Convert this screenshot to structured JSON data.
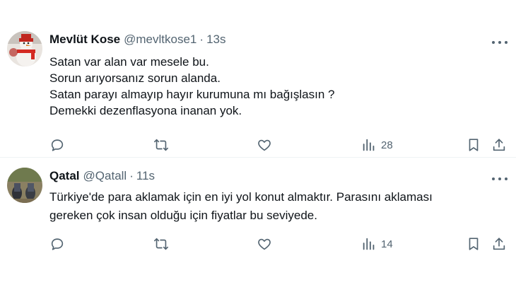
{
  "tweets": [
    {
      "name": "Mevlüt Kose",
      "handle": "@mevltkose1",
      "separator": "·",
      "time": "13s",
      "lines": [
        "Satan var alan var mesele bu.",
        "Sorun arıyorsanız sorun alanda.",
        "Satan parayı almayıp hayır kurumuna mı bağışlasın ?",
        "Demekki dezenflasyona inanan yok."
      ],
      "views": "28",
      "icons": [
        "reply-icon",
        "retweet-icon",
        "like-icon",
        "views-icon",
        "bookmark-icon",
        "share-icon",
        "more-icon"
      ]
    },
    {
      "name": "Qatal",
      "handle": "@Qatall",
      "separator": "·",
      "time": "11s",
      "lines": [
        "Türkiye'de para aklamak için en iyi yol konut almaktır. Parasını aklaması",
        "gereken çok insan olduğu için fiyatlar bu seviyede."
      ],
      "views": "14",
      "icons": [
        "reply-icon",
        "retweet-icon",
        "like-icon",
        "views-icon",
        "bookmark-icon",
        "share-icon",
        "more-icon"
      ]
    }
  ],
  "colors": {
    "text": "#0f1419",
    "secondary": "#536471",
    "divider": "#eff3f4",
    "background": "#ffffff"
  }
}
